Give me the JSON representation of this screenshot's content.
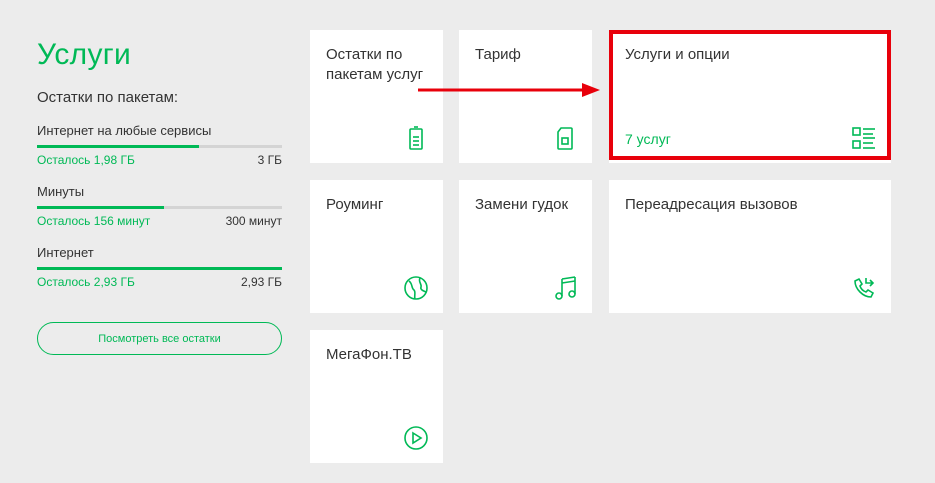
{
  "page": {
    "title": "Услуги"
  },
  "packages": {
    "heading": "Остатки по пакетам:",
    "items": [
      {
        "name": "Интернет на любые сервисы",
        "remaining": "Осталось 1,98 ГБ",
        "total": "3 ГБ",
        "fill_percent": 66
      },
      {
        "name": "Минуты",
        "remaining": "Осталось 156 минут",
        "total": "300 минут",
        "fill_percent": 52
      },
      {
        "name": "Интернет",
        "remaining": "Осталось 2,93 ГБ",
        "total": "2,93 ГБ",
        "fill_percent": 100
      }
    ],
    "view_all_label": "Посмотреть все остатки"
  },
  "tiles": [
    {
      "title": "Остатки по пакетам услуг",
      "subtitle": "",
      "icon": "battery-icon"
    },
    {
      "title": "Тариф",
      "subtitle": "",
      "icon": "sim-card-icon"
    },
    {
      "title": "Услуги и опции",
      "subtitle": "7 услуг",
      "icon": "list-grid-icon"
    },
    {
      "title": "Роуминг",
      "subtitle": "",
      "icon": "globe-icon"
    },
    {
      "title": "Замени гудок",
      "subtitle": "",
      "icon": "music-note-icon"
    },
    {
      "title": "Переадресация вызовов",
      "subtitle": "",
      "icon": "call-forward-icon"
    },
    {
      "title": "МегаФон.ТВ",
      "subtitle": "",
      "icon": "play-icon"
    }
  ],
  "colors": {
    "accent": "#00b956",
    "highlight": "#e8000b",
    "background": "#ececec",
    "tile": "#ffffff"
  }
}
